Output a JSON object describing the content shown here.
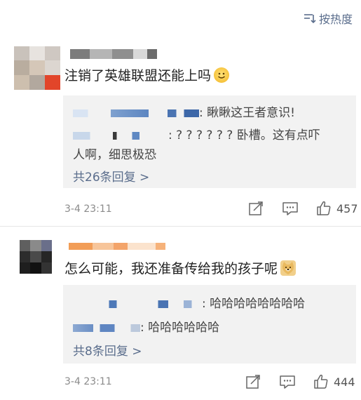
{
  "sort_label": "按热度",
  "comments": [
    {
      "text": "注销了英雄联盟还能上吗",
      "emoji": "smile-emoji",
      "replies": [
        {
          "text": ": 瞅瞅这王者意识!"
        },
        {
          "text": ": ? ? ? ? ? ?  卧槽。这有点吓",
          "text2": "人啊，细思极恐"
        }
      ],
      "more_replies": "共26条回复 >",
      "time": "3-4 23:11",
      "likes": "457"
    },
    {
      "text": "怎么可能，我还准备传给我的孩子呢",
      "emoji": "doge-emoji",
      "replies": [
        {
          "text": ": 哈哈哈哈哈哈哈哈"
        },
        {
          "text": ": 哈哈哈哈哈哈"
        }
      ],
      "more_replies": "共8条回复 >",
      "time": "3-4 23:11",
      "likes": "444"
    }
  ]
}
